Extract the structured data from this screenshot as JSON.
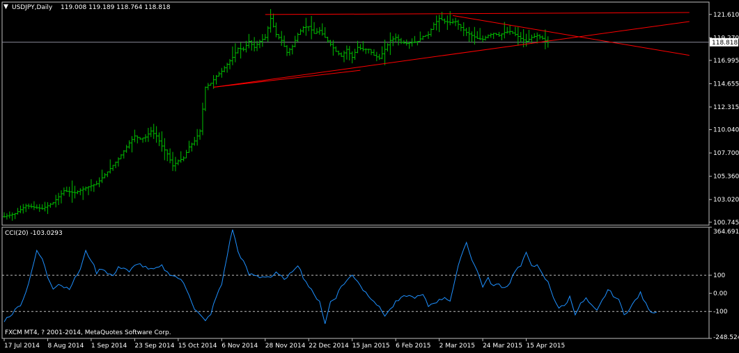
{
  "window": {
    "symbol_title": "USDJPY,Daily",
    "ohlc_text": "119.008 119.189 118.764 118.818",
    "indicator_title": "CCI(20) -103.0293",
    "copyright": "FXCM MT4, ? 2001-2014, MetaQuotes Software Corp."
  },
  "colors": {
    "background": "#000000",
    "bars": "#00c000",
    "cci_line": "#1e90ff",
    "trendlines": "#ff0000",
    "axis": "#c0c0c0",
    "text": "#ffffff"
  },
  "chart_data": [
    {
      "type": "ohlc",
      "title": "USDJPY,Daily",
      "ylim": [
        100.45,
        122.85
      ],
      "y_ticks": [
        "121.610",
        "119.270",
        "116.995",
        "114.655",
        "112.315",
        "110.040",
        "107.700",
        "105.360",
        "103.020",
        "100.745"
      ],
      "current_price_label": "118.818",
      "current_price": 118.818,
      "x_ticks": [
        {
          "label": "17 Jul 2014",
          "bar": 0
        },
        {
          "label": "8 Aug 2014",
          "bar": 16
        },
        {
          "label": "1 Sep 2014",
          "bar": 32
        },
        {
          "label": "23 Sep 2014",
          "bar": 48
        },
        {
          "label": "15 Oct 2014",
          "bar": 64
        },
        {
          "label": "6 Nov 2014",
          "bar": 80
        },
        {
          "label": "28 Nov 2014",
          "bar": 96
        },
        {
          "label": "22 Dec 2014",
          "bar": 112
        },
        {
          "label": "15 Jan 2015",
          "bar": 128
        },
        {
          "label": "6 Feb 2015",
          "bar": 144
        },
        {
          "label": "2 Mar 2015",
          "bar": 160
        },
        {
          "label": "24 Mar 2015",
          "bar": 176
        },
        {
          "label": "15 Apr 2015",
          "bar": 192
        }
      ],
      "series": [
        {
          "close_points": [
            [
              0,
              101.3
            ],
            [
              4,
              101.6
            ],
            [
              8,
              102.4
            ],
            [
              10,
              102.3
            ],
            [
              14,
              102.1
            ],
            [
              18,
              102.7
            ],
            [
              22,
              103.9
            ],
            [
              26,
              103.7
            ],
            [
              30,
              104.2
            ],
            [
              34,
              104.6
            ],
            [
              38,
              105.8
            ],
            [
              42,
              107.1
            ],
            [
              46,
              108.7
            ],
            [
              48,
              109.4
            ],
            [
              50,
              109.1
            ],
            [
              52,
              109.3
            ],
            [
              54,
              109.9
            ],
            [
              56,
              109.4
            ],
            [
              58,
              108.4
            ],
            [
              60,
              107.6
            ],
            [
              62,
              106.4
            ],
            [
              64,
              106.9
            ],
            [
              66,
              107.2
            ],
            [
              68,
              108.3
            ],
            [
              70,
              108.9
            ],
            [
              72,
              109.9
            ],
            [
              74,
              114.3
            ],
            [
              76,
              114.7
            ],
            [
              78,
              115.4
            ],
            [
              80,
              115.9
            ],
            [
              82,
              116.6
            ],
            [
              84,
              117.3
            ],
            [
              86,
              118.2
            ],
            [
              88,
              118.1
            ],
            [
              90,
              118.9
            ],
            [
              92,
              118.3
            ],
            [
              94,
              118.9
            ],
            [
              96,
              119.3
            ],
            [
              98,
              121.2
            ],
            [
              100,
              119.6
            ],
            [
              102,
              119.0
            ],
            [
              104,
              117.8
            ],
            [
              106,
              118.4
            ],
            [
              108,
              119.6
            ],
            [
              110,
              120.3
            ],
            [
              112,
              120.4
            ],
            [
              114,
              119.7
            ],
            [
              116,
              120.0
            ],
            [
              118,
              119.3
            ],
            [
              120,
              118.6
            ],
            [
              122,
              117.9
            ],
            [
              124,
              117.4
            ],
            [
              126,
              118.1
            ],
            [
              128,
              117.3
            ],
            [
              130,
              118.3
            ],
            [
              132,
              118.1
            ],
            [
              134,
              118.1
            ],
            [
              136,
              117.5
            ],
            [
              138,
              117.2
            ],
            [
              140,
              118.1
            ],
            [
              142,
              119.0
            ],
            [
              144,
              119.3
            ],
            [
              146,
              118.8
            ],
            [
              148,
              118.7
            ],
            [
              150,
              118.8
            ],
            [
              152,
              118.9
            ],
            [
              154,
              119.4
            ],
            [
              156,
              119.6
            ],
            [
              158,
              120.6
            ],
            [
              160,
              121.2
            ],
            [
              162,
              120.9
            ],
            [
              164,
              120.8
            ],
            [
              166,
              120.9
            ],
            [
              168,
              120.3
            ],
            [
              170,
              119.8
            ],
            [
              172,
              119.5
            ],
            [
              174,
              119.2
            ],
            [
              176,
              119.1
            ],
            [
              178,
              119.5
            ],
            [
              180,
              119.7
            ],
            [
              182,
              119.5
            ],
            [
              184,
              119.8
            ],
            [
              186,
              119.9
            ],
            [
              188,
              119.6
            ],
            [
              190,
              119.2
            ],
            [
              192,
              118.9
            ],
            [
              194,
              119.3
            ],
            [
              196,
              119.5
            ],
            [
              198,
              119.2
            ],
            [
              200,
              118.8
            ]
          ]
        }
      ],
      "trendlines": [
        {
          "from": [
            77,
            114.3
          ],
          "to": [
            252,
            120.9
          ]
        },
        {
          "from": [
            77,
            114.3
          ],
          "to": [
            131,
            116.0
          ]
        },
        {
          "from": [
            96,
            121.6
          ],
          "to": [
            252,
            121.8
          ]
        },
        {
          "from": [
            165,
            121.5
          ],
          "to": [
            252,
            117.5
          ]
        }
      ]
    },
    {
      "type": "line",
      "title": "CCI(20) -103.0293",
      "ylim": [
        -248.5249,
        364.691
      ],
      "y_ticks": [
        "364.691",
        "100",
        "0.00",
        "-100",
        "-248.5249"
      ],
      "dashed_levels": [
        100,
        -100
      ],
      "series": [
        {
          "values": [
            [
              0,
              -150
            ],
            [
              3,
              -110
            ],
            [
              6,
              -60
            ],
            [
              8,
              5
            ],
            [
              10,
              120
            ],
            [
              12,
              230
            ],
            [
              14,
              190
            ],
            [
              16,
              90
            ],
            [
              18,
              30
            ],
            [
              20,
              55
            ],
            [
              22,
              35
            ],
            [
              24,
              30
            ],
            [
              26,
              80
            ],
            [
              28,
              135
            ],
            [
              30,
              230
            ],
            [
              32,
              185
            ],
            [
              34,
              115
            ],
            [
              36,
              140
            ],
            [
              38,
              115
            ],
            [
              40,
              95
            ],
            [
              42,
              140
            ],
            [
              44,
              145
            ],
            [
              46,
              120
            ],
            [
              48,
              150
            ],
            [
              50,
              160
            ],
            [
              52,
              145
            ],
            [
              54,
              130
            ],
            [
              56,
              135
            ],
            [
              58,
              150
            ],
            [
              60,
              115
            ],
            [
              62,
              100
            ],
            [
              64,
              85
            ],
            [
              66,
              55
            ],
            [
              68,
              -5
            ],
            [
              70,
              -85
            ],
            [
              72,
              -120
            ],
            [
              74,
              -155
            ],
            [
              76,
              -110
            ],
            [
              78,
              -20
            ],
            [
              80,
              50
            ],
            [
              82,
              210
            ],
            [
              84,
              355
            ],
            [
              86,
              230
            ],
            [
              88,
              175
            ],
            [
              90,
              105
            ],
            [
              92,
              100
            ],
            [
              94,
              90
            ],
            [
              96,
              95
            ],
            [
              98,
              90
            ],
            [
              100,
              110
            ],
            [
              102,
              90
            ],
            [
              104,
              80
            ],
            [
              106,
              125
            ],
            [
              108,
              160
            ],
            [
              110,
              90
            ],
            [
              112,
              40
            ],
            [
              114,
              -10
            ],
            [
              116,
              -40
            ],
            [
              118,
              -170
            ],
            [
              120,
              -45
            ],
            [
              122,
              -20
            ],
            [
              124,
              40
            ],
            [
              126,
              70
            ],
            [
              128,
              100
            ],
            [
              130,
              70
            ],
            [
              132,
              20
            ],
            [
              134,
              -10
            ],
            [
              136,
              -40
            ],
            [
              138,
              -80
            ],
            [
              140,
              -120
            ],
            [
              142,
              -90
            ],
            [
              144,
              -50
            ],
            [
              146,
              -30
            ],
            [
              148,
              -10
            ],
            [
              150,
              -20
            ],
            [
              152,
              -20
            ],
            [
              154,
              -10
            ],
            [
              156,
              -70
            ],
            [
              158,
              -50
            ],
            [
              160,
              -40
            ],
            [
              162,
              -20
            ],
            [
              164,
              -40
            ],
            [
              166,
              80
            ],
            [
              168,
              210
            ],
            [
              170,
              280
            ],
            [
              172,
              190
            ],
            [
              174,
              120
            ],
            [
              176,
              40
            ],
            [
              178,
              80
            ],
            [
              180,
              40
            ],
            [
              182,
              50
            ],
            [
              184,
              30
            ],
            [
              186,
              60
            ],
            [
              188,
              130
            ],
            [
              190,
              150
            ],
            [
              192,
              220
            ],
            [
              194,
              160
            ],
            [
              196,
              150
            ],
            [
              198,
              100
            ],
            [
              200,
              60
            ],
            [
              202,
              -20
            ],
            [
              204,
              -80
            ],
            [
              206,
              -70
            ],
            [
              208,
              -20
            ],
            [
              210,
              -110
            ],
            [
              212,
              -60
            ],
            [
              214,
              -30
            ],
            [
              216,
              -70
            ],
            [
              218,
              -100
            ],
            [
              220,
              -40
            ],
            [
              222,
              20
            ],
            [
              224,
              -10
            ],
            [
              226,
              -40
            ],
            [
              228,
              -110
            ],
            [
              230,
              -90
            ],
            [
              232,
              -40
            ],
            [
              234,
              0
            ],
            [
              236,
              -60
            ],
            [
              238,
              -100
            ],
            [
              240,
              -103
            ]
          ]
        }
      ]
    }
  ]
}
